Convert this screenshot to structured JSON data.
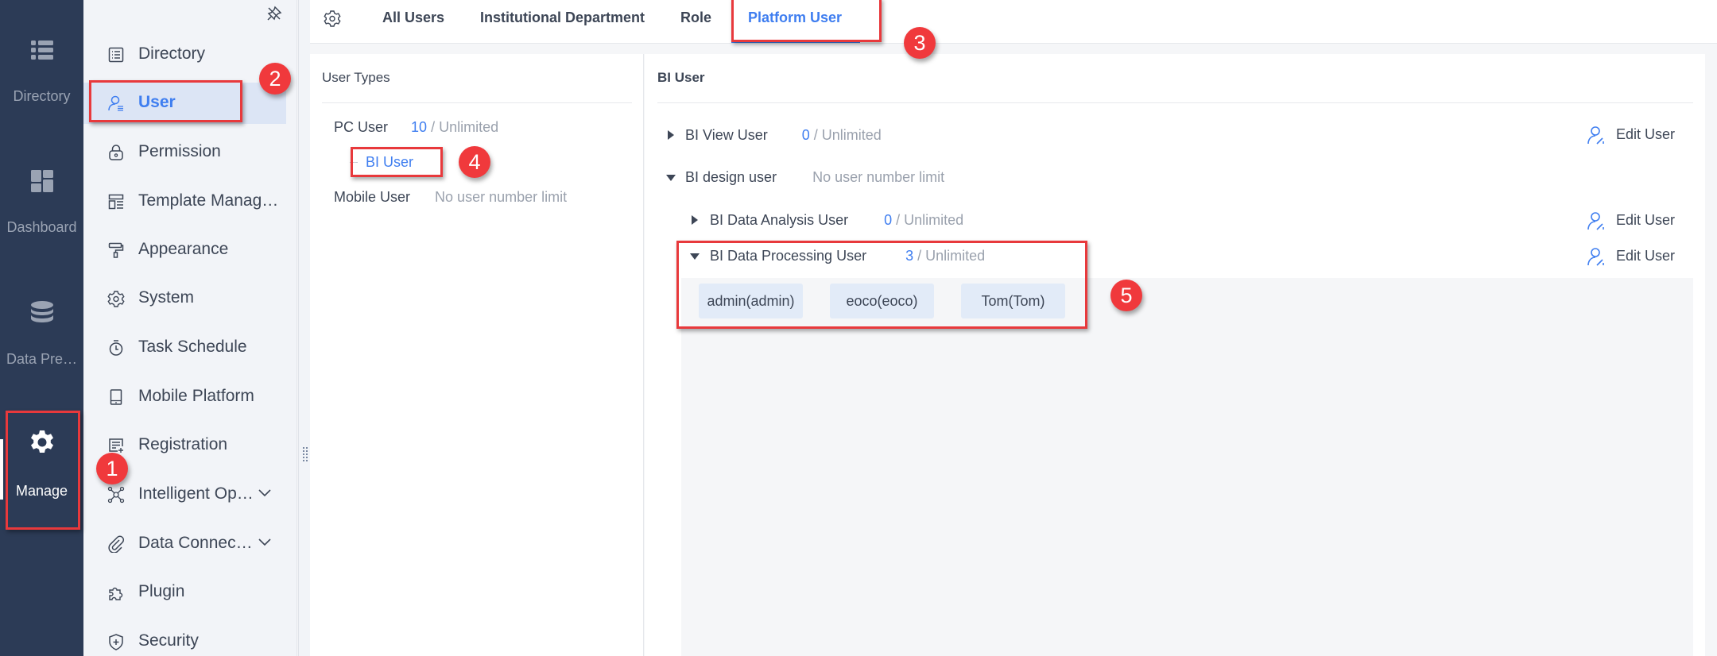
{
  "rail": {
    "items": [
      {
        "label": "Directory",
        "icon": "list-icon"
      },
      {
        "label": "Dashboard",
        "icon": "dashboard-icon"
      },
      {
        "label": "Data Pre…",
        "icon": "database-icon"
      },
      {
        "label": "Manage",
        "icon": "gear-icon",
        "active": true
      }
    ]
  },
  "sidebar": {
    "items": [
      {
        "label": "Directory",
        "icon": "directory-icon"
      },
      {
        "label": "User",
        "icon": "user-icon",
        "active": true
      },
      {
        "label": "Permission",
        "icon": "lock-icon"
      },
      {
        "label": "Template Manag…",
        "icon": "template-icon"
      },
      {
        "label": "Appearance",
        "icon": "paint-roller-icon"
      },
      {
        "label": "System",
        "icon": "settings-icon"
      },
      {
        "label": "Task Schedule",
        "icon": "timer-icon"
      },
      {
        "label": "Mobile Platform",
        "icon": "mobile-icon"
      },
      {
        "label": "Registration",
        "icon": "registration-icon"
      },
      {
        "label": "Intelligent Op…",
        "icon": "network-icon",
        "expandable": true
      },
      {
        "label": "Data Connec…",
        "icon": "paperclip-icon",
        "expandable": true
      },
      {
        "label": "Plugin",
        "icon": "puzzle-icon"
      },
      {
        "label": "Security",
        "icon": "shield-icon"
      }
    ]
  },
  "tabs": {
    "items": [
      {
        "label": "All Users"
      },
      {
        "label": "Institutional Department"
      },
      {
        "label": "Role"
      },
      {
        "label": "Platform User",
        "active": true
      }
    ]
  },
  "user_types": {
    "title": "User Types",
    "pc_user": {
      "label": "PC User",
      "count": "10",
      "limit": " / Unlimited"
    },
    "bi_user_link": "BI User",
    "mobile_user": {
      "label": "Mobile User",
      "limit": "No user number limit"
    }
  },
  "bi_user": {
    "title": "BI User",
    "view_user": {
      "label": "BI View User",
      "count": "0",
      "limit": " / Unlimited",
      "edit": "Edit User"
    },
    "design_user": {
      "label": "BI design user",
      "limit": "No user number limit"
    },
    "analysis_user": {
      "label": "BI Data Analysis User",
      "count": "0",
      "limit": " / Unlimited",
      "edit": "Edit User"
    },
    "processing_user": {
      "label": "BI Data Processing User",
      "count": "3",
      "limit": " / Unlimited",
      "edit": "Edit User"
    },
    "processing_members": [
      "admin(admin)",
      "eoco(eoco)",
      "Tom(Tom)"
    ]
  },
  "annotations": {
    "badges": [
      "1",
      "2",
      "3",
      "4",
      "5"
    ]
  },
  "colors": {
    "accent": "#3f7ef0",
    "rail_bg": "#2c3b56",
    "annotation_red": "#e8393c"
  }
}
